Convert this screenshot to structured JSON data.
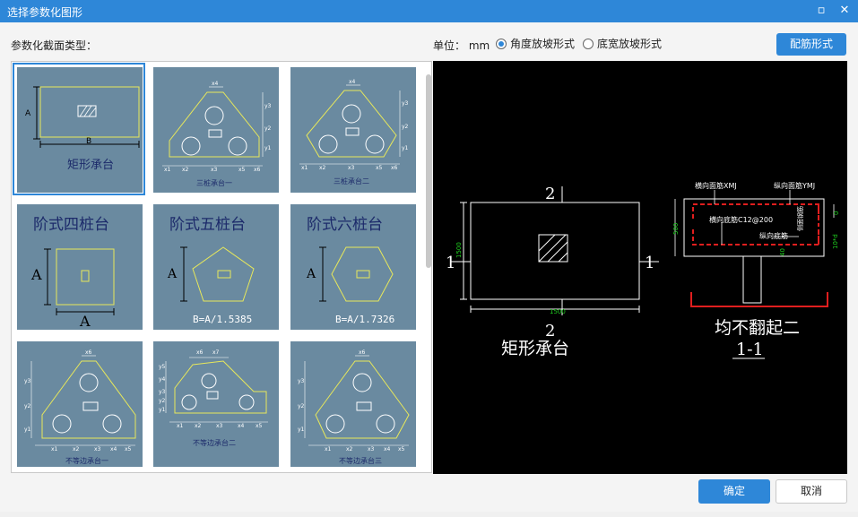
{
  "window": {
    "title": "选择参数化图形"
  },
  "toolbar": {
    "section_label": "参数化截面类型：",
    "unit_label": "单位：",
    "unit_value": "mm",
    "radio_angle": "角度放坡形式",
    "radio_width": "底宽放坡形式",
    "rebar_button": "配筋形式"
  },
  "footer": {
    "ok": "确定",
    "cancel": "取消"
  },
  "shapes": [
    {
      "label": "矩形承台",
      "dim_a": "A",
      "dim_b": "B"
    },
    {
      "label": "三桩承台一",
      "dims": [
        "x4",
        "y3",
        "y2",
        "y1",
        "x1",
        "x2",
        "x3",
        "x5",
        "x6"
      ]
    },
    {
      "label": "三桩承台二",
      "dims": [
        "x4",
        "y3",
        "y2",
        "y1",
        "x1",
        "x2",
        "x3",
        "x5",
        "x6"
      ]
    },
    {
      "label": "阶式四桩台",
      "dim_a": "A",
      "dim_b": "A"
    },
    {
      "label": "阶式五桩台",
      "dim_a": "A",
      "formula": "B=A/1.5385"
    },
    {
      "label": "阶式六桩台",
      "dim_a": "A",
      "formula": "B=A/1.7326"
    },
    {
      "label": "不等边承台一",
      "dims": [
        "x6",
        "y3",
        "y2",
        "y1",
        "x1",
        "x2",
        "x3",
        "x4",
        "x5"
      ]
    },
    {
      "label": "不等边承台二",
      "dims": [
        "x6",
        "x7",
        "y5",
        "y4",
        "y3",
        "y2",
        "y1",
        "x1",
        "x2",
        "x3",
        "x4",
        "x5"
      ]
    },
    {
      "label": "不等边承台三",
      "dims": [
        "x6",
        "y3",
        "y2",
        "y1",
        "x1",
        "x2",
        "x3",
        "x4",
        "x5"
      ]
    }
  ],
  "preview": {
    "plan_label": "矩形承台",
    "section_mark_top": "2",
    "section_mark_bottom": "2",
    "left_mark": "1",
    "right_mark": "1",
    "dim_height": "1500",
    "dim_width": "1500",
    "label_top_h": "横向面筋XMJ",
    "label_top_v": "纵向面筋YMJ",
    "label_bottom_h": "横向底筋C12@200",
    "label_bottom_v": "纵向底筋",
    "label_side": "侧面钢筋",
    "dim_section_h": "500",
    "dim_side": "10*d",
    "dim_small": "40",
    "dim_z": "0",
    "section_caption": "均不翻起二",
    "section_name": "1-1"
  }
}
